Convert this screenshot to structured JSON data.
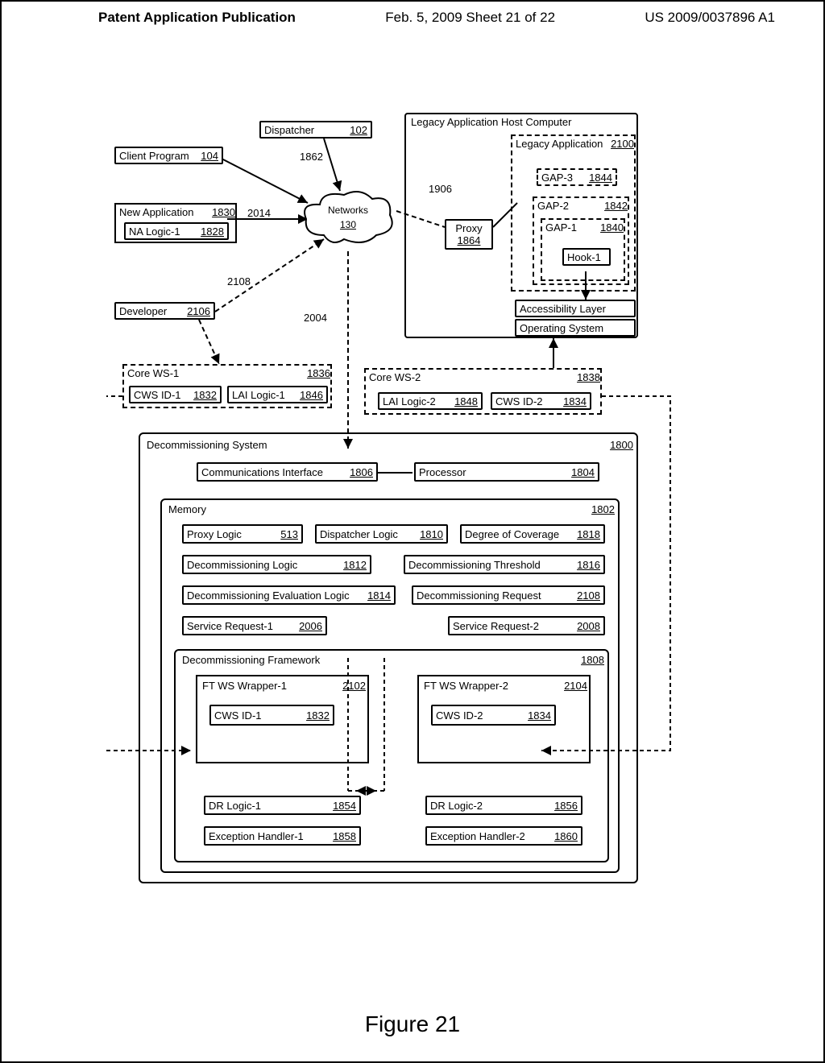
{
  "header": {
    "left": "Patent Application Publication",
    "mid": "Feb. 5, 2009  Sheet 21 of 22",
    "right": "US 2009/0037896 A1"
  },
  "figure_caption": "Figure 21",
  "components": {
    "client_program": {
      "label": "Client Program",
      "ref": "104"
    },
    "new_application": {
      "label": "New Application",
      "ref": "1830"
    },
    "na_logic": {
      "label": "NA Logic-1",
      "ref": "1828"
    },
    "developer": {
      "label": "Developer",
      "ref": "2106"
    },
    "dispatcher": {
      "label": "Dispatcher",
      "ref": "102"
    },
    "networks": {
      "label": "Networks",
      "ref": "130"
    },
    "proxy": {
      "label": "Proxy",
      "ref": "1864"
    },
    "legacy_host": {
      "label": "Legacy Application Host Computer"
    },
    "legacy_app": {
      "label": "Legacy Application",
      "ref": "2100"
    },
    "gap3": {
      "label": "GAP-3",
      "ref": "1844"
    },
    "gap2": {
      "label": "GAP-2",
      "ref": "1842"
    },
    "gap1": {
      "label": "GAP-1",
      "ref": "1840"
    },
    "hook1": {
      "label": "Hook-1"
    },
    "access_layer": {
      "label": "Accessibility Layer"
    },
    "os": {
      "label": "Operating System"
    },
    "core_ws1": {
      "label": "Core WS-1",
      "ref": "1836"
    },
    "cws_id1": {
      "label": "CWS ID-1",
      "ref": "1832"
    },
    "lai_logic1": {
      "label": "LAI Logic-1",
      "ref": "1846"
    },
    "core_ws2": {
      "label": "Core WS-2",
      "ref": "1838"
    },
    "lai_logic2": {
      "label": "LAI Logic-2",
      "ref": "1848"
    },
    "cws_id2": {
      "label": "CWS ID-2",
      "ref": "1834"
    },
    "decom_sys": {
      "label": "Decommissioning System",
      "ref": "1800"
    },
    "comm_if": {
      "label": "Communications Interface",
      "ref": "1806"
    },
    "processor": {
      "label": "Processor",
      "ref": "1804"
    },
    "memory": {
      "label": "Memory",
      "ref": "1802"
    },
    "proxy_logic": {
      "label": "Proxy Logic",
      "ref": "513"
    },
    "dispatcher_logic": {
      "label": "Dispatcher Logic",
      "ref": "1810"
    },
    "degree_cov": {
      "label": "Degree of Coverage",
      "ref": "1818"
    },
    "decom_logic": {
      "label": "Decommissioning Logic",
      "ref": "1812"
    },
    "decom_thresh": {
      "label": "Decommissioning Threshold",
      "ref": "1816"
    },
    "decom_eval": {
      "label": "Decommissioning Evaluation Logic",
      "ref": "1814"
    },
    "decom_req": {
      "label": "Decommissioning Request",
      "ref": "2108"
    },
    "svc_req1": {
      "label": "Service Request-1",
      "ref": "2006"
    },
    "svc_req2": {
      "label": "Service Request-2",
      "ref": "2008"
    },
    "decom_fw": {
      "label": "Decommissioning Framework",
      "ref": "1808"
    },
    "ft_wrap1": {
      "label": "FT WS Wrapper-1",
      "ref": "2102"
    },
    "ft_wrap2": {
      "label": "FT WS Wrapper-2",
      "ref": "2104"
    },
    "cws_id1b": {
      "label": "CWS ID-1",
      "ref": "1832"
    },
    "cws_id2b": {
      "label": "CWS ID-2",
      "ref": "1834"
    },
    "dr_logic1": {
      "label": "DR Logic-1",
      "ref": "1854"
    },
    "dr_logic2": {
      "label": "DR Logic-2",
      "ref": "1856"
    },
    "exc_h1": {
      "label": "Exception Handler-1",
      "ref": "1858"
    },
    "exc_h2": {
      "label": "Exception Handler-2",
      "ref": "1860"
    },
    "n1862": "1862",
    "n2014": "2014",
    "n2108": "2108",
    "n2004": "2004",
    "n1906": "1906"
  }
}
